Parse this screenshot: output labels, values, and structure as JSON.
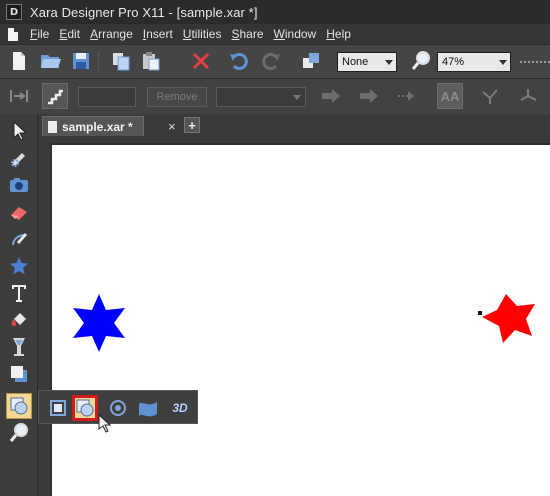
{
  "window": {
    "logo_letter": "D",
    "title": "Xara Designer Pro X11 - [sample.xar *]"
  },
  "menu": [
    {
      "label": "File",
      "key": "F",
      "rest": "ile"
    },
    {
      "label": "Edit",
      "key": "E",
      "rest": "dit"
    },
    {
      "label": "Arrange",
      "key": "A",
      "rest": "rrange"
    },
    {
      "label": "Insert",
      "key": "I",
      "rest": "nsert"
    },
    {
      "label": "Utilities",
      "key": "U",
      "rest": "tilities"
    },
    {
      "label": "Share",
      "key": "S",
      "rest": "hare"
    },
    {
      "label": "Window",
      "key": "W",
      "rest": "indow"
    },
    {
      "label": "Help",
      "key": "H",
      "rest": "elp"
    }
  ],
  "toolbar": {
    "quality_value": "None",
    "zoom_value": "47%",
    "remove_label": "Remove",
    "aa_label": "AA"
  },
  "tabs": {
    "doc_tab_label": "sample.xar *",
    "close_glyph": "×",
    "add_glyph": "+"
  },
  "left_tools": [
    "selector-tool-icon",
    "contour-tool-icon",
    "photo-tool-icon",
    "eraser-tool-icon",
    "freehand-tool-icon",
    "star-tool-icon",
    "text-tool-icon",
    "fill-tool-icon",
    "transparency-tool-icon",
    "shadow-tool-icon",
    "mould-tool-icon",
    "zoom-tool-icon"
  ],
  "flyout": {
    "three_d_label": "3D"
  },
  "canvas": {
    "star_blue_color": "#0000ff",
    "star_red_color": "#ff0000"
  },
  "colors": {
    "selection_highlight": "#d21b1b",
    "active_tool_bg": "#f3d797"
  }
}
